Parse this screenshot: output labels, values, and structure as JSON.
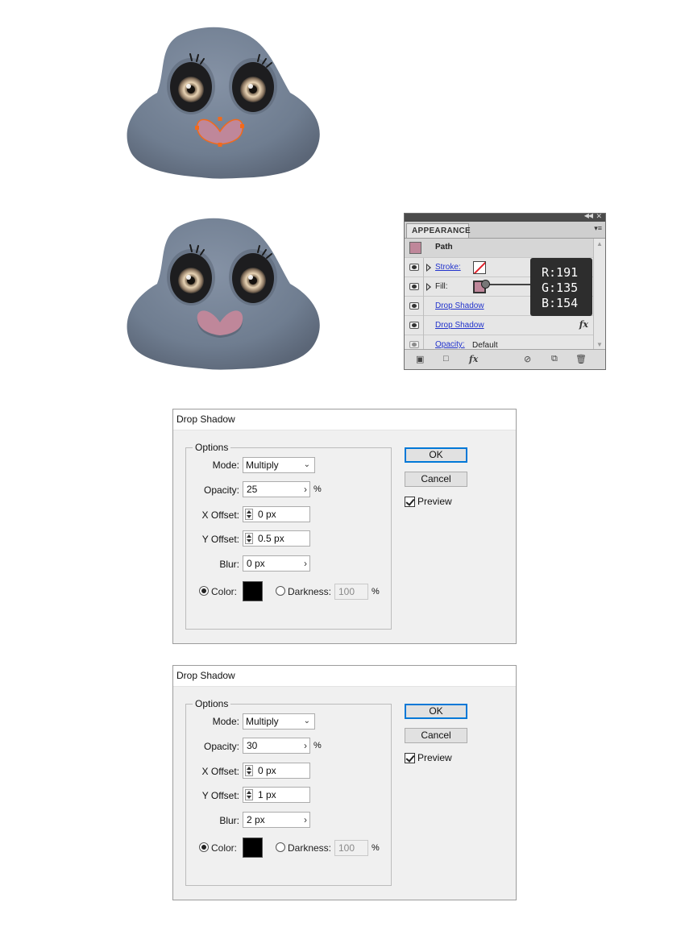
{
  "illustrations": [
    {
      "name": "mole-with-path-selected",
      "body_color": "#6f7d90",
      "nose_color": "#bf879a",
      "selection_color": "#f26a1b"
    },
    {
      "name": "mole-final",
      "body_color": "#6f7d90",
      "nose_color": "#bf879a"
    }
  ],
  "appearance_panel": {
    "tab_label": "APPEARANCE",
    "path_label": "Path",
    "path_swatch_color": "#bf879a",
    "rows": [
      {
        "label": "Stroke:",
        "kind": "stroke"
      },
      {
        "label": "Fill:",
        "kind": "fill",
        "color": "#bf879a"
      },
      {
        "label": "Drop Shadow",
        "kind": "effect"
      },
      {
        "label": "Drop Shadow",
        "kind": "effect",
        "fx": "fx"
      },
      {
        "label": "Opacity:",
        "kind": "opacity",
        "value": "Default"
      }
    ],
    "bottom_fx": "fx"
  },
  "rgb_tooltip": {
    "r": "R:191",
    "g": "G:135",
    "b": "B:154"
  },
  "dialogs": [
    {
      "title": "Drop Shadow",
      "group_title": "Options",
      "mode_label": "Mode:",
      "mode_value": "Multiply",
      "opacity_label": "Opacity:",
      "opacity_value": "25",
      "opacity_unit": "%",
      "x_offset_label": "X Offset:",
      "x_offset_value": "0 px",
      "y_offset_label": "Y Offset:",
      "y_offset_value": "0.5 px",
      "blur_label": "Blur:",
      "blur_value": "0 px",
      "color_label": "Color:",
      "color_value": "#000000",
      "darkness_label": "Darkness:",
      "darkness_value": "100",
      "darkness_unit": "%",
      "ok_label": "OK",
      "cancel_label": "Cancel",
      "preview_label": "Preview"
    },
    {
      "title": "Drop Shadow",
      "group_title": "Options",
      "mode_label": "Mode:",
      "mode_value": "Multiply",
      "opacity_label": "Opacity:",
      "opacity_value": "30",
      "opacity_unit": "%",
      "x_offset_label": "X Offset:",
      "x_offset_value": "0 px",
      "y_offset_label": "Y Offset:",
      "y_offset_value": "1 px",
      "blur_label": "Blur:",
      "blur_value": "2 px",
      "color_label": "Color:",
      "color_value": "#000000",
      "darkness_label": "Darkness:",
      "darkness_value": "100",
      "darkness_unit": "%",
      "ok_label": "OK",
      "cancel_label": "Cancel",
      "preview_label": "Preview"
    }
  ]
}
